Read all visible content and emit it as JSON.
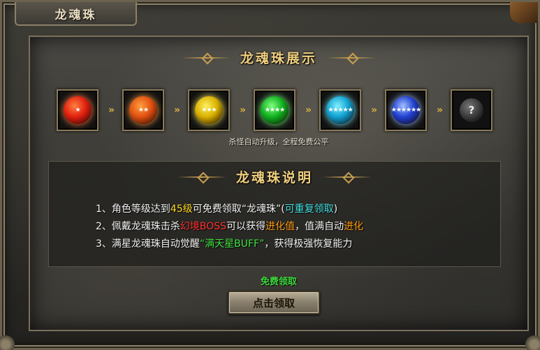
{
  "window": {
    "title": "龙魂珠"
  },
  "showcase": {
    "title": "龙魂珠展示",
    "orbs": [
      {
        "icon": "dragon-orb-red-icon",
        "color": "#e02010",
        "glow": "#ff8040",
        "stars": "★"
      },
      {
        "icon": "dragon-orb-orange-icon",
        "color": "#e05010",
        "glow": "#ffa040",
        "stars": "★★"
      },
      {
        "icon": "dragon-orb-yellow-icon",
        "color": "#d8b000",
        "glow": "#fff060",
        "stars": "★★★"
      },
      {
        "icon": "dragon-orb-green-icon",
        "color": "#10b020",
        "glow": "#80ff80",
        "stars": "★★★★"
      },
      {
        "icon": "dragon-orb-cyan-icon",
        "color": "#10a0d0",
        "glow": "#80f0ff",
        "stars": "★★★★★"
      },
      {
        "icon": "dragon-orb-blue-icon",
        "color": "#2040d0",
        "glow": "#a0c0ff",
        "stars": "★★★★★★"
      },
      {
        "icon": "unknown-orb-icon",
        "color": "#444444",
        "glow": "#888888",
        "stars": "?"
      }
    ],
    "arrow_glyph": "»",
    "caption": "杀怪自动升级，全程免费公平"
  },
  "description": {
    "title": "龙魂珠说明",
    "line1": {
      "a": "1、角色等级达到",
      "b": "45级",
      "c": "可免费领取“龙魂珠”(",
      "d": "可重复领取",
      "e": ")"
    },
    "line2": {
      "a": "2、佩戴龙魂珠击杀",
      "b": "幻境BOSS",
      "c": "可以获得",
      "d": "进化值",
      "e": "，值满自动",
      "f": "进化"
    },
    "line3": {
      "a": "3、满星龙魂珠自动觉醒",
      "b": "“满天星BUFF”",
      "c": "，获得极强恢复能力"
    }
  },
  "claim": {
    "free_label": "免费领取",
    "button_label": "点击领取"
  }
}
